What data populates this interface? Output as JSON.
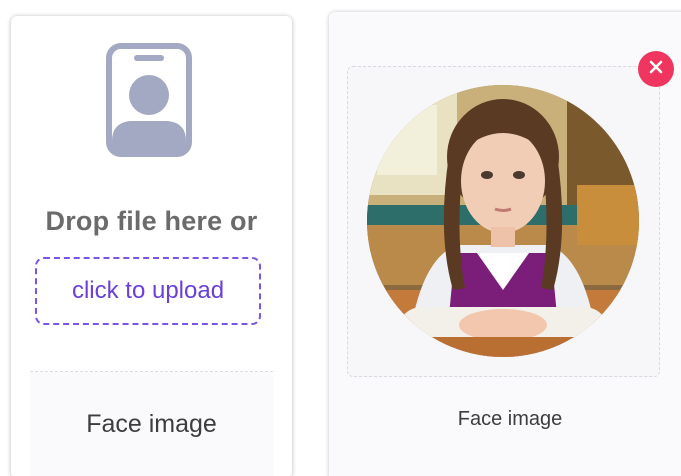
{
  "upload_card": {
    "icon": "id-badge-icon",
    "drop_text": "Drop file here or",
    "upload_button_label": "click to upload",
    "footer_label": "Face image"
  },
  "preview_card": {
    "image": "face-photo-girl-at-desk",
    "remove_icon": "close-icon",
    "footer_label": "Face image"
  },
  "colors": {
    "accent": "#7b53e6",
    "remove": "#f0365f",
    "icon_gray": "#a3a8c3",
    "text_gray": "#6b6b6b"
  }
}
